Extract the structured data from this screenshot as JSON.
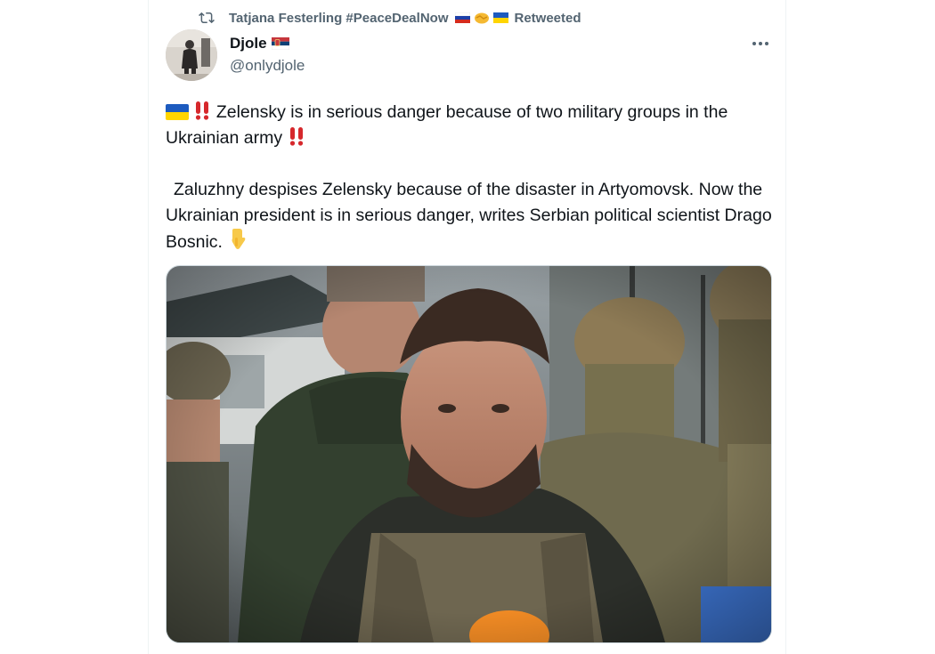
{
  "retweet": {
    "icon": "retweet-icon",
    "user": "Tatjana Festerling #PeaceDealNow",
    "flags": [
      "russia-flag",
      "handshake-emoji",
      "ukraine-flag"
    ],
    "status": "Retweeted"
  },
  "author": {
    "name": "Djole",
    "name_flag": "serbia-flag",
    "handle": "@onlydjole",
    "avatar": "avatar"
  },
  "tweet": {
    "line1_text": "Zelensky is in serious danger because of two military groups in the Ukrainian army",
    "line1_icons": [
      "ukraine-flag",
      "double-exclamation-icon",
      "double-exclamation-icon"
    ],
    "para2_text": "Zaluzhny despises Zelensky because of the disaster in Artyomovsk. Now the Ukrainian president is in serious danger, writes Serbian political scientist Drago Bosnic.",
    "para2_icon": "pointing-down-emoji"
  },
  "media": {
    "image": "tweet-photo"
  },
  "colors": {
    "text": "#0f1419",
    "secondary": "#536471",
    "border": "#eff3f4",
    "alert_red": "#d6282c",
    "ukraine_blue": "#1d5bbf",
    "ukraine_yellow": "#ffd500"
  }
}
